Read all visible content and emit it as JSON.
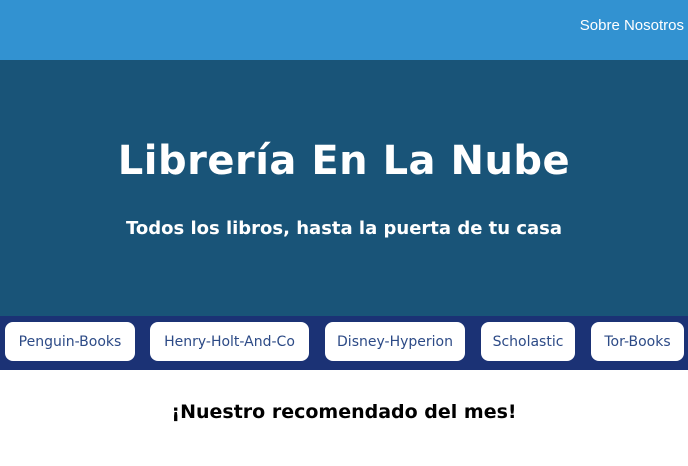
{
  "nav": {
    "about_label": "Sobre Nosotros"
  },
  "hero": {
    "title": "Librería En La Nube",
    "subtitle": "Todos los libros, hasta la puerta de tu casa"
  },
  "publishers": [
    {
      "label": "Penguin-Books"
    },
    {
      "label": "Henry-Holt-And-Co"
    },
    {
      "label": "Disney-Hyperion"
    },
    {
      "label": "Scholastic"
    },
    {
      "label": "Tor-Books"
    }
  ],
  "recommendation": {
    "heading": "¡Nuestro recomendado del mes!"
  },
  "colors": {
    "topbar": "#3292d1",
    "hero": "#195478",
    "publisher_bar": "#1b3275",
    "button_text": "#2c4a86"
  }
}
